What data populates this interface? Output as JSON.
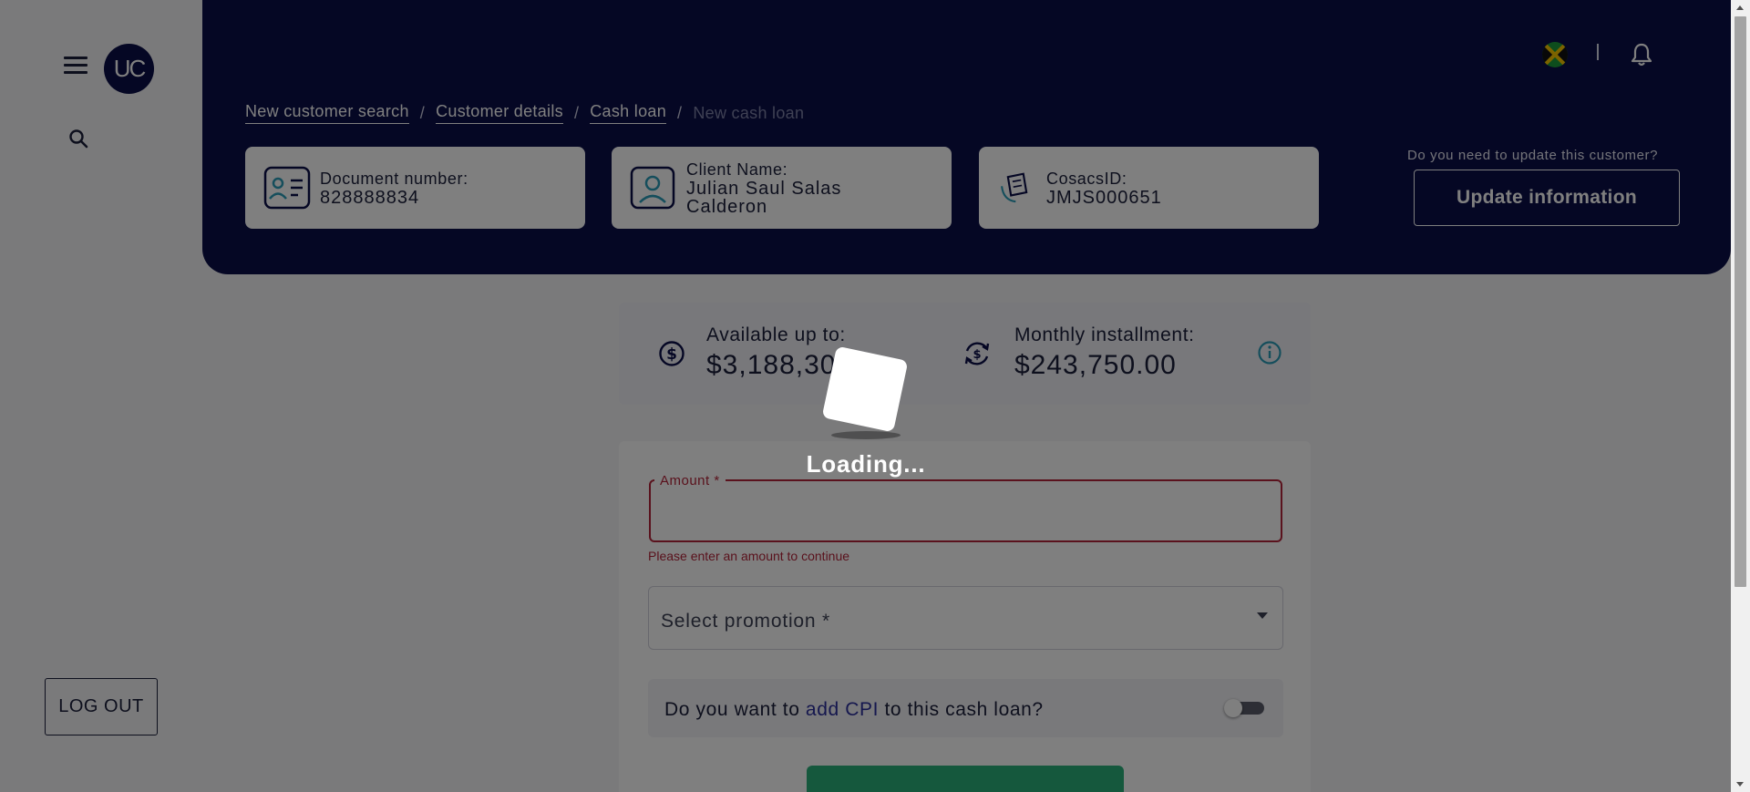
{
  "sidebar": {
    "avatar_initials": "UC",
    "logout_label": "LOG OUT"
  },
  "header": {
    "breadcrumbs": [
      {
        "label": "New customer search"
      },
      {
        "label": "Customer details"
      },
      {
        "label": "Cash loan"
      },
      {
        "label": "New cash loan"
      }
    ],
    "separator": "/",
    "cards": [
      {
        "label": "Document number:",
        "value": "828888834",
        "icon": "id-card-icon"
      },
      {
        "label": "Client Name:",
        "value_line1": "Julian Saul Salas",
        "value_line2": "Calderon",
        "icon": "person-icon"
      },
      {
        "label": "CosacsID:",
        "value": "JMJS000651",
        "icon": "cosacs-logo-icon"
      }
    ],
    "update_question": "Do you need to update this customer?",
    "update_button": "Update information",
    "flag_country": "jamaica-flag-icon"
  },
  "summary": {
    "available_label": "Available up to:",
    "available_value": "$3,188,30",
    "installment_label": "Monthly installment:",
    "installment_value": "$243,750.00"
  },
  "form": {
    "amount_label": "Amount *",
    "amount_value": "",
    "amount_error": "Please enter an amount to continue",
    "promotion_placeholder": "Select promotion *",
    "cpi_prefix": "Do you want to ",
    "cpi_accent": "add CPI",
    "cpi_suffix": " to this cash loan?",
    "cpi_enabled": false
  },
  "loading": {
    "text": "Loading..."
  },
  "colors": {
    "header_bg": "#0b0e49",
    "error": "#b5253a",
    "accent_green": "#2bb07b",
    "teal_icon": "#2a9db8"
  }
}
